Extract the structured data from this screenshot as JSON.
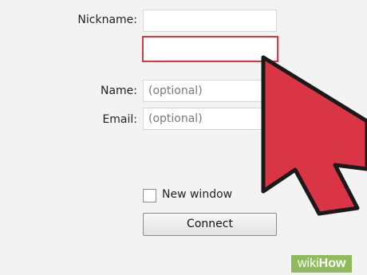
{
  "form": {
    "nickname_label": "Nickname:",
    "nickname_value": "",
    "second_field_value": "",
    "name_label": "Name:",
    "name_placeholder": "(optional)",
    "email_label": "Email:",
    "email_placeholder": "(optional)",
    "new_window_label": "New window",
    "new_window_checked": false,
    "connect_label": "Connect"
  },
  "overlay": {
    "arrow_icon": "cursor-arrow-icon",
    "arrow_color": "#d93545",
    "highlight_color": "#d93545"
  },
  "watermark": {
    "part1": "wiki",
    "part2": "How",
    "background": "#8fbb5a"
  }
}
